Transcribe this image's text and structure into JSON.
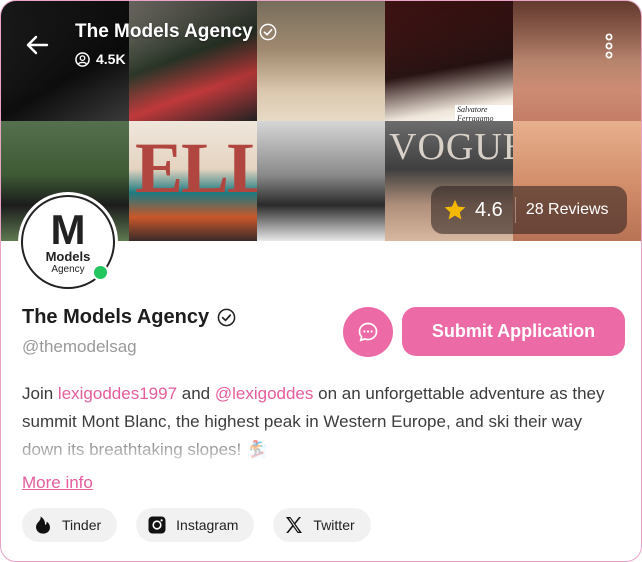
{
  "header": {
    "title": "The Models Agency",
    "followers": "4.5K",
    "back_icon": "arrow-left-icon",
    "menu_icon": "kebab-menu-icon",
    "collage_texts": {
      "ell": "ELLE",
      "vogue": "VOGUE",
      "ferragamo": "Salvatore Ferragamo"
    }
  },
  "rating": {
    "score": "4.6",
    "reviews": "28 Reviews",
    "star_color": "#f5b800"
  },
  "profile": {
    "avatar_monogram": "M",
    "avatar_line1": "Models",
    "avatar_line2": "Agency",
    "name": "The Models Agency",
    "handle": "@themodelsag",
    "online": true
  },
  "actions": {
    "chat_icon": "chat-bubble-icon",
    "submit_label": "Submit Application",
    "accent": "#ec6aa6"
  },
  "description": {
    "prefix": "Join ",
    "mention1": "lexigoddes1997",
    "middle": " and ",
    "mention2": "@lexigoddes",
    "suffix": " on an unforgettable adventure as they summit Mont Blanc, the highest peak in Western Europe, and ski their way down its breathtaking slopes! 🏂"
  },
  "more_info": "More info",
  "socials": [
    {
      "label": "Tinder",
      "icon": "tinder-flame-icon"
    },
    {
      "label": "Instagram",
      "icon": "instagram-icon"
    },
    {
      "label": "Twitter",
      "icon": "x-logo-icon"
    }
  ]
}
